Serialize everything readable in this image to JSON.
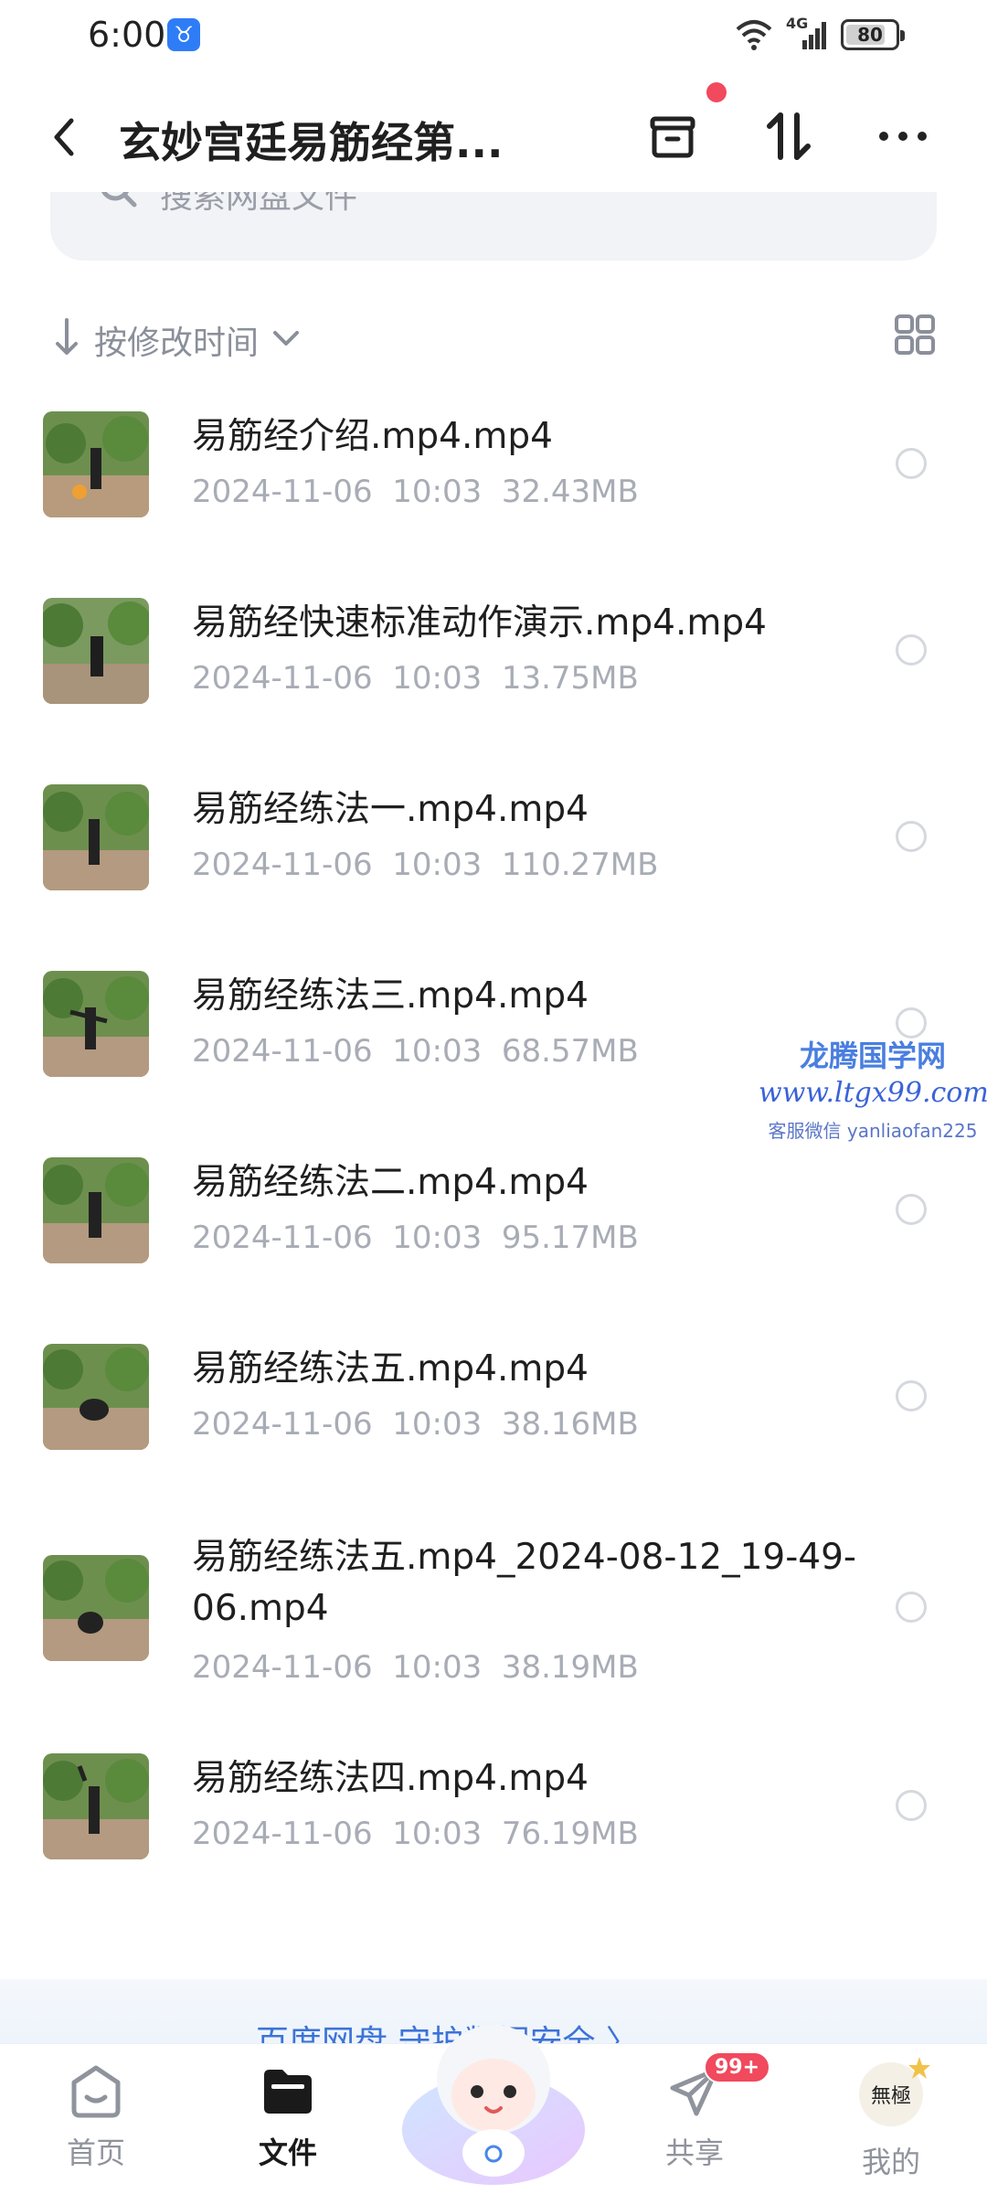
{
  "status_bar": {
    "time": "6:00",
    "app_icon_glyph": "♉",
    "network_label": "4G",
    "battery": "80",
    "battery_level": 0.8
  },
  "header": {
    "title": "玄妙宫廷易筋经第...",
    "has_notification_dot": true
  },
  "search": {
    "placeholder": "搜索网盘文件"
  },
  "sort": {
    "label": "按修改时间"
  },
  "files": [
    {
      "name": "易筋经介绍.mp4.mp4",
      "date": "2024-11-06",
      "time": "10:03",
      "size": "32.43MB"
    },
    {
      "name": "易筋经快速标准动作演示.mp4.mp4",
      "date": "2024-11-06",
      "time": "10:03",
      "size": "13.75MB"
    },
    {
      "name": "易筋经练法一.mp4.mp4",
      "date": "2024-11-06",
      "time": "10:03",
      "size": "110.27MB"
    },
    {
      "name": "易筋经练法三.mp4.mp4",
      "date": "2024-11-06",
      "time": "10:03",
      "size": "68.57MB"
    },
    {
      "name": "易筋经练法二.mp4.mp4",
      "date": "2024-11-06",
      "time": "10:03",
      "size": "95.17MB"
    },
    {
      "name": "易筋经练法五.mp4.mp4",
      "date": "2024-11-06",
      "time": "10:03",
      "size": "38.16MB"
    },
    {
      "name": "易筋经练法五.mp4_2024-08-12_19-49-06.mp4",
      "date": "2024-11-06",
      "time": "10:03",
      "size": "38.19MB"
    },
    {
      "name": "易筋经练法四.mp4.mp4",
      "date": "2024-11-06",
      "time": "10:03",
      "size": "76.19MB"
    }
  ],
  "watermark": {
    "line1": "龙腾国学网",
    "line2": "www.ltgx99.com",
    "line3": "客服微信 yanliaofan225"
  },
  "banner": {
    "text": "百度网盘 守护数据安全 〉"
  },
  "tabs": [
    {
      "label": "首页",
      "icon": "home-face-icon",
      "active": false
    },
    {
      "label": "文件",
      "icon": "folder-icon",
      "active": true
    },
    {
      "label": "共享",
      "icon": "paper-plane-icon",
      "active": false,
      "badge": "99+"
    },
    {
      "label": "我的",
      "icon": "avatar-icon",
      "active": false,
      "avatar_text": "無極"
    }
  ],
  "colors": {
    "accent": "#f1495d",
    "link": "#3c73d8",
    "meta_gray": "#a8acb5"
  }
}
